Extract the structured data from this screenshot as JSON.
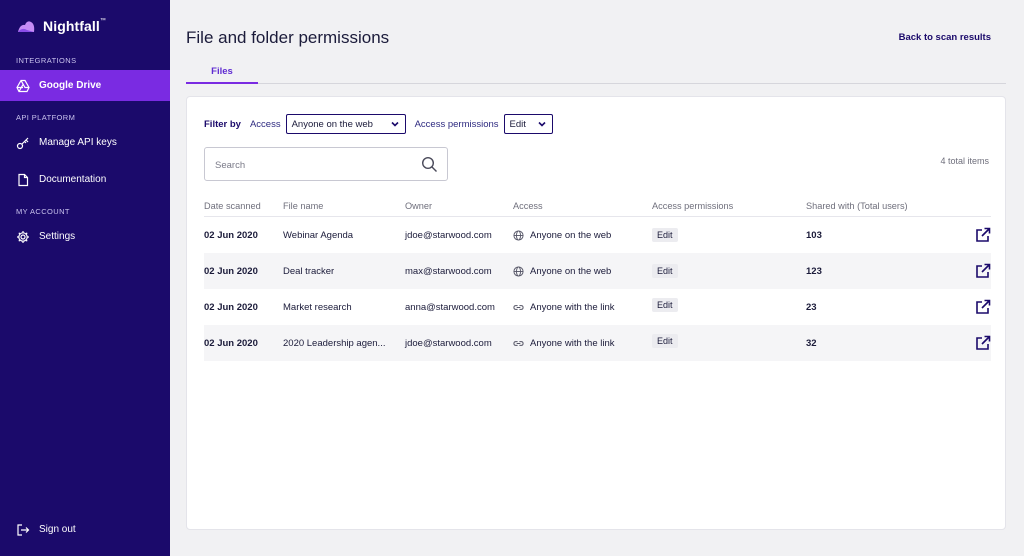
{
  "brand": {
    "name": "Nightfall",
    "tm": "™"
  },
  "sidebar": {
    "sections": {
      "integrations": "INTEGRATIONS",
      "api_platform": "API PLATFORM",
      "my_account": "MY ACCOUNT"
    },
    "items": [
      {
        "label": "Google Drive",
        "icon": "google-drive-icon",
        "active": true
      },
      {
        "label": "Manage API keys",
        "icon": "key-icon"
      },
      {
        "label": "Documentation",
        "icon": "document-icon"
      },
      {
        "label": "Settings",
        "icon": "gear-icon"
      },
      {
        "label": "Sign out",
        "icon": "sign-out-icon"
      }
    ],
    "colors": {
      "background": "#1b0a6b",
      "active": "#7a2be2"
    }
  },
  "header": {
    "title": "File and folder permissions",
    "back_link": "Back to scan results"
  },
  "tabs": [
    {
      "label": "Files",
      "active": true
    }
  ],
  "filters": {
    "label": "Filter by",
    "access_label": "Access",
    "access_value": "Anyone on the web",
    "permissions_label": "Access permissions",
    "permissions_value": "Edit"
  },
  "search": {
    "placeholder": "Search"
  },
  "total_items": "4 total items",
  "table": {
    "columns": [
      "Date scanned",
      "File name",
      "Owner",
      "Access",
      "Access permissions",
      "Shared with (Total users)"
    ],
    "rows": [
      {
        "date": "02 Jun 2020",
        "file": "Webinar Agenda",
        "owner": "jdoe@starwood.com",
        "access": "Anyone on the web",
        "access_icon": "globe-icon",
        "permission": "Edit",
        "shared": "103"
      },
      {
        "date": "02 Jun 2020",
        "file": "Deal tracker",
        "owner": "max@starwood.com",
        "access": "Anyone on the web",
        "access_icon": "globe-icon",
        "permission": "Edit",
        "shared": "123"
      },
      {
        "date": "02 Jun 2020",
        "file": "Market research",
        "owner": "anna@starwood.com",
        "access": "Anyone with the link",
        "access_icon": "link-icon",
        "permission": "Edit",
        "shared": "23"
      },
      {
        "date": "02 Jun 2020",
        "file": "2020 Leadership agen...",
        "owner": "jdoe@starwood.com",
        "access": "Anyone with the link",
        "access_icon": "link-icon",
        "permission": "Edit",
        "shared": "32"
      }
    ]
  }
}
